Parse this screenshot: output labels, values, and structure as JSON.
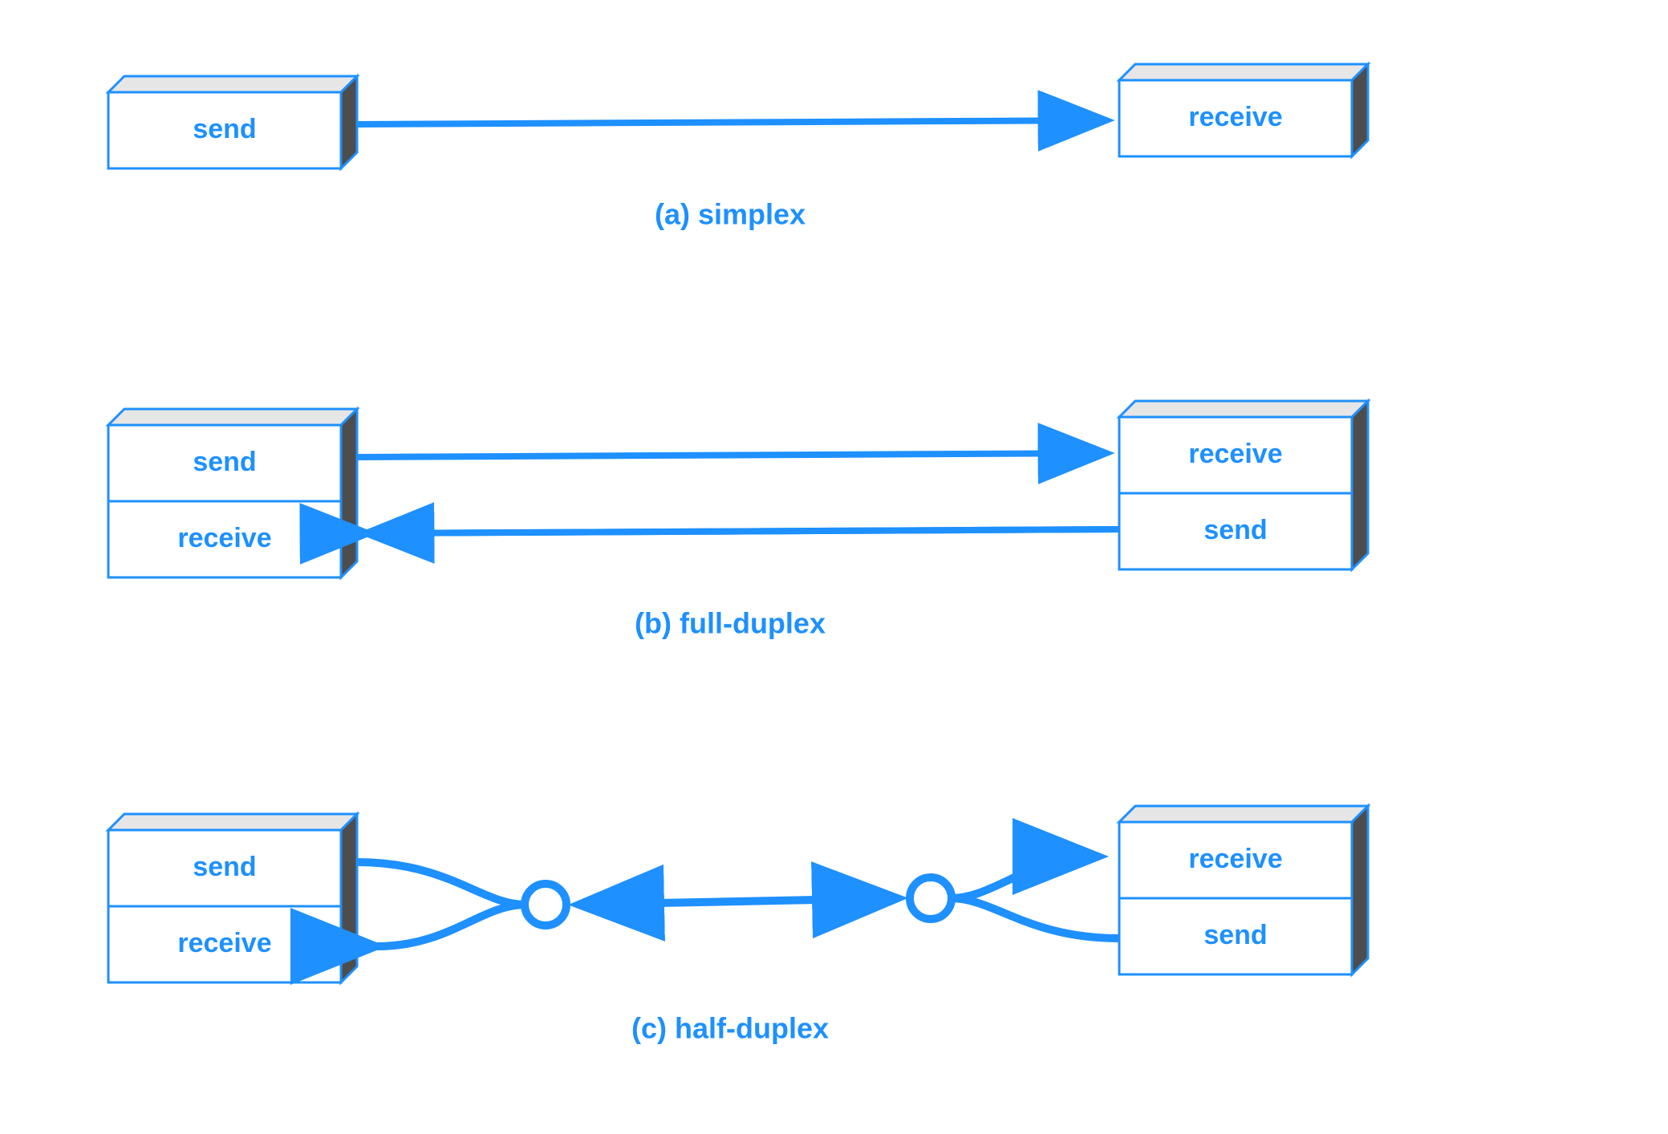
{
  "colors": {
    "stroke": "#1e90ff",
    "boxTop": "#e6e6e6",
    "boxSide": "#4d4d4d",
    "boxFront": "#ffffff"
  },
  "sections": {
    "a": {
      "caption": "(a)  simplex",
      "left": {
        "rows": [
          "send"
        ]
      },
      "right": {
        "rows": [
          "receive"
        ]
      }
    },
    "b": {
      "caption": "(b)  full-duplex",
      "left": {
        "rows": [
          "send",
          "receive"
        ]
      },
      "right": {
        "rows": [
          "receive",
          "send"
        ]
      }
    },
    "c": {
      "caption": "(c)  half-duplex",
      "left": {
        "rows": [
          "send",
          "receive"
        ]
      },
      "right": {
        "rows": [
          "receive",
          "send"
        ]
      }
    }
  }
}
